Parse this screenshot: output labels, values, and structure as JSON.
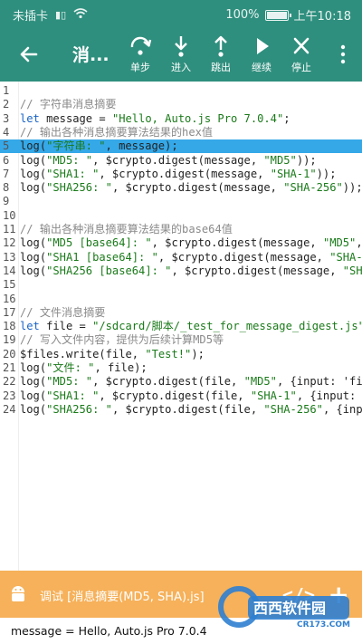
{
  "status_bar": {
    "carrier": "未插卡",
    "battery": "100%",
    "battery_level": 1.0,
    "time": "上午10:18"
  },
  "toolbar": {
    "title": "消...",
    "tools": [
      {
        "label": "单步",
        "icon": "step-over-icon"
      },
      {
        "label": "进入",
        "icon": "step-into-icon"
      },
      {
        "label": "跳出",
        "icon": "step-out-icon"
      },
      {
        "label": "继续",
        "icon": "play-icon"
      },
      {
        "label": "停止",
        "icon": "close-icon"
      }
    ]
  },
  "editor": {
    "lines": [
      {
        "n": "1",
        "text": ""
      },
      {
        "n": "2",
        "text": "// 字符串消息摘要",
        "type": "comment"
      },
      {
        "n": "3",
        "text": "let message = \"Hello, Auto.js Pro 7.0.4\";"
      },
      {
        "n": "4",
        "text": "// 输出各种消息摘要算法结果的hex值",
        "type": "comment"
      },
      {
        "n": "5",
        "text": "log(\"字符串: \", message);",
        "highlight": true
      },
      {
        "n": "6",
        "text": "log(\"MD5: \", $crypto.digest(message, \"MD5\"));"
      },
      {
        "n": "7",
        "text": "log(\"SHA1: \", $crypto.digest(message, \"SHA-1\"));"
      },
      {
        "n": "8",
        "text": "log(\"SHA256: \", $crypto.digest(message, \"SHA-256\"));"
      },
      {
        "n": "9",
        "text": ""
      },
      {
        "n": "10",
        "text": ""
      },
      {
        "n": "11",
        "text": "// 输出各种消息摘要算法结果的base64值",
        "type": "comment"
      },
      {
        "n": "12",
        "text": "log(\"MD5 [base64]: \", $crypto.digest(message, \"MD5\", {"
      },
      {
        "n": "13",
        "text": "log(\"SHA1 [base64]: \", $crypto.digest(message, \"SHA-1\""
      },
      {
        "n": "14",
        "text": "log(\"SHA256 [base64]: \", $crypto.digest(message, \"SHA-"
      },
      {
        "n": "15",
        "text": ""
      },
      {
        "n": "16",
        "text": ""
      },
      {
        "n": "17",
        "text": "// 文件消息摘要",
        "type": "comment"
      },
      {
        "n": "18",
        "text": "let file = \"/sdcard/脚本/_test_for_message_digest.js\""
      },
      {
        "n": "19",
        "text": "// 写入文件内容，提供为后续计算MD5等",
        "type": "comment"
      },
      {
        "n": "20",
        "text": "$files.write(file, \"Test!\");"
      },
      {
        "n": "21",
        "text": "log(\"文件: \", file);"
      },
      {
        "n": "22",
        "text": "log(\"MD5: \", $crypto.digest(file, \"MD5\", {input: 'file"
      },
      {
        "n": "23",
        "text": "log(\"SHA1: \", $crypto.digest(file, \"SHA-1\", {input: 'f"
      },
      {
        "n": "24",
        "text": "log(\"SHA256: \", $crypto.digest(file, \"SHA-256\", {input"
      }
    ]
  },
  "debug_bar": {
    "title": "调试 [消息摘要(MD5, SHA).js]",
    "code_icon": "</>",
    "plus": "+"
  },
  "console": {
    "output": "message = Hello, Auto.js Pro 7.0.4"
  },
  "watermark": {
    "text": "西西软件园",
    "sub": "CR173.COM"
  },
  "colors": {
    "primary": "#2f8f7e",
    "highlight": "#35a8e8",
    "debug_bar": "#f6b15a",
    "keyword": "#1a64c8",
    "string": "#1a7a1a",
    "comment": "#8a8a8a"
  }
}
